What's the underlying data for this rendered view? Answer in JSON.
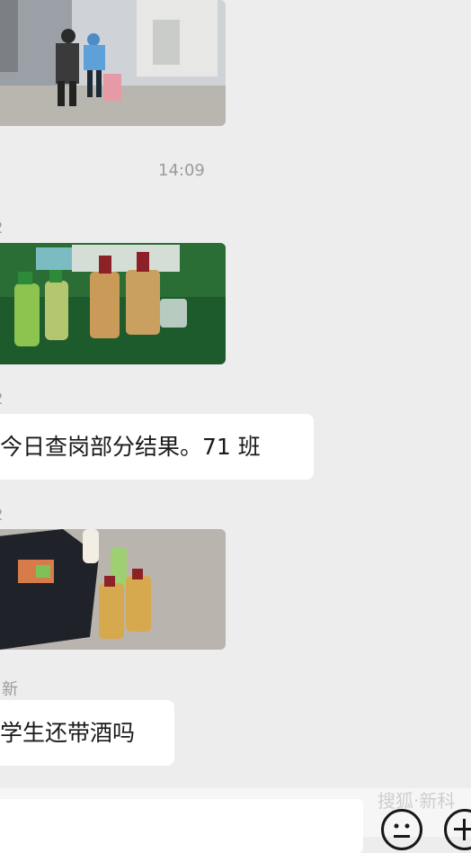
{
  "messages": [
    {
      "type": "image",
      "description_icon": "photo-icon"
    },
    {
      "type": "time",
      "text": "14:09"
    },
    {
      "type": "sender",
      "text": "2"
    },
    {
      "type": "image",
      "description_icon": "photo-icon"
    },
    {
      "type": "sender",
      "text": "2"
    },
    {
      "type": "text",
      "text": "今日查岗部分结果。71 班"
    },
    {
      "type": "sender",
      "text": "2"
    },
    {
      "type": "image",
      "description_icon": "photo-icon"
    },
    {
      "type": "sender",
      "text": "新"
    },
    {
      "type": "text",
      "text": "学生还带酒吗"
    }
  ],
  "watermark": "搜狐·新科",
  "colors": {
    "background": "#ededed",
    "bubble": "#ffffff",
    "meta_text": "#9b9b9b"
  }
}
